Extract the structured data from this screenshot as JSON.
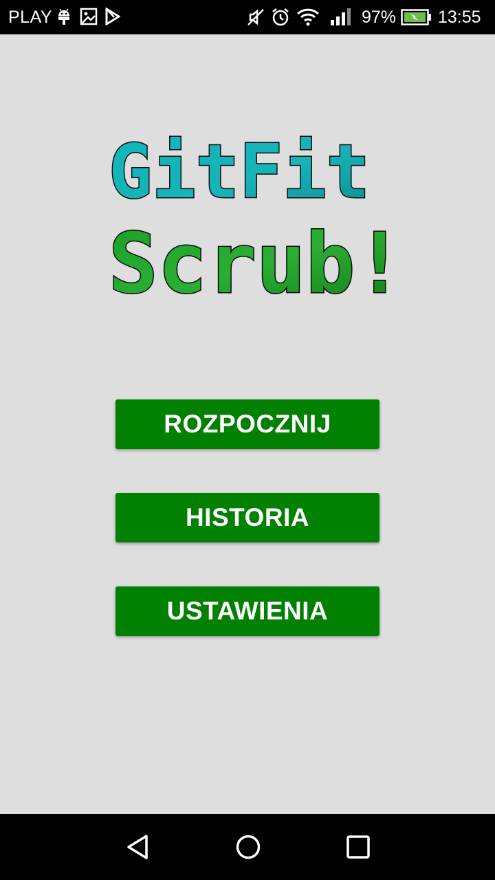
{
  "status_bar": {
    "carrier": "PLAY",
    "battery_percent": "97%",
    "time": "13:55",
    "icons": [
      "android-debug-icon",
      "image-icon",
      "play-store-icon",
      "muted-icon",
      "alarm-icon",
      "wifi-icon",
      "signal-icon",
      "battery-charging-icon"
    ]
  },
  "logo": {
    "line1": "GitFit",
    "line2": "Scrub!",
    "colors": {
      "line1": "#12b3b8",
      "line2": "#16911e"
    }
  },
  "menu": {
    "start_label": "ROZPOCZNIJ",
    "history_label": "HISTORIA",
    "settings_label": "USTAWIENIA",
    "button_color": "#028002"
  },
  "nav_bar": {
    "icons": [
      "back-icon",
      "home-icon",
      "recents-icon"
    ]
  }
}
